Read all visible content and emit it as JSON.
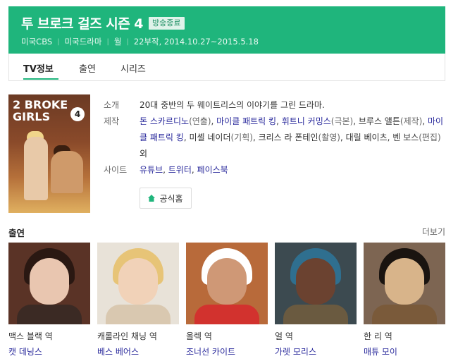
{
  "header": {
    "title": "투 브로크 걸즈 시즌 4",
    "badge": "방송종료",
    "meta": [
      "미국CBS",
      "미국드라마",
      "월",
      "22부작, 2014.10.27~2015.5.18"
    ]
  },
  "tabs": [
    {
      "label": "TV정보",
      "active": true
    },
    {
      "label": "출연",
      "active": false
    },
    {
      "label": "시리즈",
      "active": false
    }
  ],
  "poster": {
    "title_line1": "2 BROKE",
    "title_line2": "GIRLS",
    "season": "4"
  },
  "info": {
    "intro_label": "소개",
    "intro_text": "20대 중반의 두 웨이트리스의 이야기를 그린 드라마.",
    "production_label": "제작",
    "production": [
      {
        "name": "돈 스카르디노",
        "role": "(연출)",
        "link": true,
        "sep": ", "
      },
      {
        "name": "마이클 패트릭 킹",
        "role": "",
        "link": true,
        "sep": ", "
      },
      {
        "name": "휘트니 커밍스",
        "role": "(극본)",
        "link": true,
        "sep": ", "
      },
      {
        "name": "브루스 앨튼",
        "role": "(제작)",
        "link": false,
        "sep": ", "
      },
      {
        "name": "마이클 패트릭 킹",
        "role": "",
        "link": true,
        "sep": ", "
      },
      {
        "name": "미셸 네이더",
        "role": "(기획)",
        "link": false,
        "sep": ", "
      },
      {
        "name": "크리스 라 폰테인",
        "role": "(촬영)",
        "link": false,
        "sep": ", "
      },
      {
        "name": "대릴 베이츠",
        "role": "",
        "link": false,
        "sep": ", "
      },
      {
        "name": "벤 보스",
        "role": "(편집)",
        "link": false,
        "sep": " 외"
      }
    ],
    "site_label": "사이트",
    "sites": [
      "유튜브",
      "트위터",
      "페이스북"
    ],
    "home_button": "공식홈"
  },
  "cast": {
    "title": "출연",
    "more": "더보기",
    "members": [
      {
        "role": "맥스 블랙 역",
        "name": "캣 데닝스",
        "palette": {
          "bg": "#5a3326",
          "hair": "#2a1812",
          "face": "#e9c6b0",
          "body": "#3b2a24"
        }
      },
      {
        "role": "캐롤라인 채닝 역",
        "name": "베스 베어스",
        "palette": {
          "bg": "#e8e2d8",
          "hair": "#e7c477",
          "face": "#f1d2b8",
          "body": "#d9c8b0"
        }
      },
      {
        "role": "올렉 역",
        "name": "조너선 카이트",
        "palette": {
          "bg": "#b86a3a",
          "hair": "#ffffff",
          "face": "#cf9876",
          "body": "#d2322e"
        }
      },
      {
        "role": "얼 역",
        "name": "가렛 모리스",
        "palette": {
          "bg": "#3c4a50",
          "hair": "#2f6f8f",
          "face": "#6b4230",
          "body": "#6a5a40"
        }
      },
      {
        "role": "한 리 역",
        "name": "매튜 모이",
        "palette": {
          "bg": "#7d6552",
          "hair": "#1a1410",
          "face": "#d8b48a",
          "body": "#7a5a3a"
        }
      }
    ]
  }
}
